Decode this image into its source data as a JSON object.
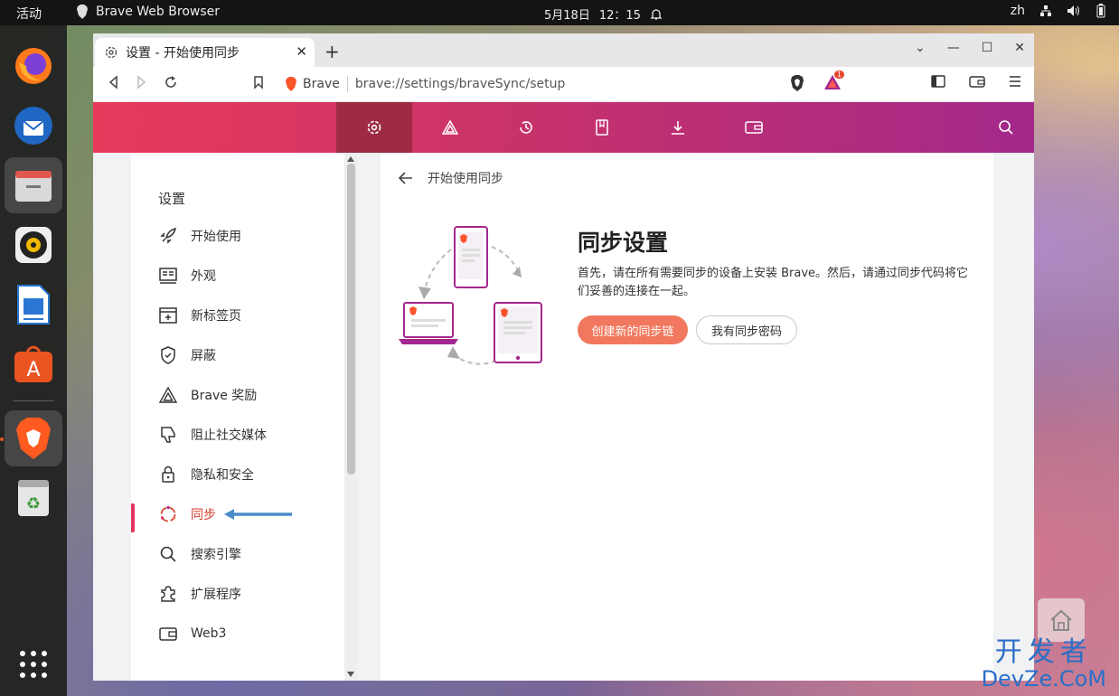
{
  "topbar": {
    "activities": "活动",
    "app_name": "Brave Web Browser",
    "date": "5月18日",
    "time": "12：15",
    "lang": "zh"
  },
  "dock": {
    "items": [
      "firefox-icon",
      "thunderbird-icon",
      "files-icon",
      "rhythmbox-icon",
      "libreoffice-writer-icon",
      "software-center-icon",
      "brave-icon",
      "trash-icon",
      "app-grid-icon"
    ]
  },
  "browser": {
    "tab_title": "设置 - 开始使用同步",
    "url_label": "Brave",
    "url": "brave://settings/braveSync/setup",
    "rewards_badge": "1"
  },
  "sidebar": {
    "heading": "设置",
    "items": [
      {
        "label": "开始使用",
        "icon": "rocket-icon"
      },
      {
        "label": "外观",
        "icon": "appearance-icon"
      },
      {
        "label": "新标签页",
        "icon": "new-tab-icon"
      },
      {
        "label": "屏蔽",
        "icon": "shield-icon"
      },
      {
        "label": "Brave 奖励",
        "icon": "rewards-triangle-icon"
      },
      {
        "label": "阻止社交媒体",
        "icon": "thumbs-down-icon"
      },
      {
        "label": "隐私和安全",
        "icon": "lock-icon"
      },
      {
        "label": "同步",
        "icon": "sync-icon",
        "active": true
      },
      {
        "label": "搜索引擎",
        "icon": "search-icon"
      },
      {
        "label": "扩展程序",
        "icon": "puzzle-icon"
      },
      {
        "label": "Web3",
        "icon": "wallet-icon"
      }
    ]
  },
  "main": {
    "breadcrumb": "开始使用同步",
    "title": "同步设置",
    "description": "首先，请在所有需要同步的设备上安装 Brave。然后，请通过同步代码将它们妥善的连接在一起。",
    "primary_button": "创建新的同步链",
    "secondary_button": "我有同步密码"
  },
  "watermark": {
    "cn": "开发者",
    "en": "DevZe.CoM"
  },
  "colors": {
    "accent_gradient_start": "#e83a5b",
    "accent_gradient_end": "#a3288a",
    "primary_button": "#f1785e",
    "active_sidebar": "#d33a2c"
  }
}
